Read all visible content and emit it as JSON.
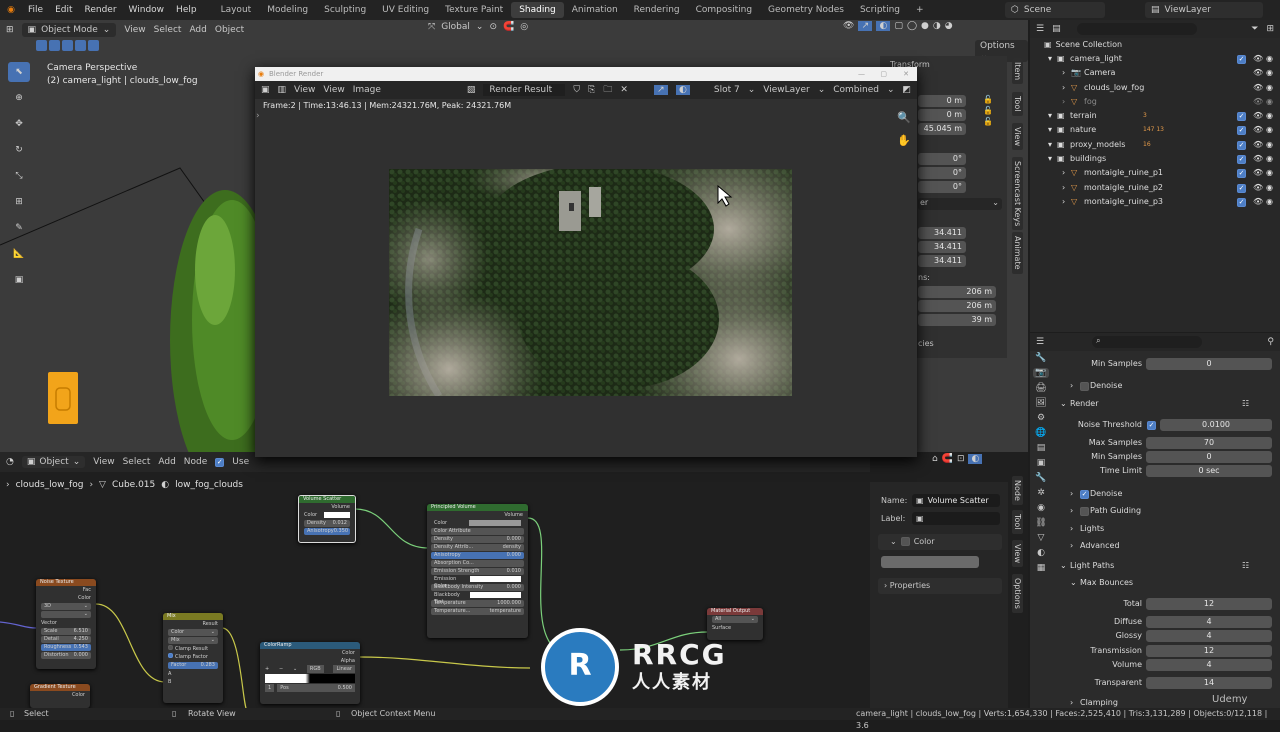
{
  "menu": {
    "items": [
      "File",
      "Edit",
      "Render",
      "Window",
      "Help"
    ]
  },
  "workspaces": {
    "tabs": [
      "Layout",
      "Modeling",
      "Sculpting",
      "UV Editing",
      "Texture Paint",
      "Shading",
      "Animation",
      "Rendering",
      "Compositing",
      "Geometry Nodes",
      "Scripting"
    ],
    "active": "Shading",
    "add": "+"
  },
  "scene": {
    "name": "Scene",
    "view_layer": "ViewLayer"
  },
  "viewport": {
    "mode": "Object Mode",
    "menus": [
      "View",
      "Select",
      "Add",
      "Object"
    ],
    "orientation": "Global",
    "options": "Options",
    "camera_title": "Camera Perspective",
    "camera_subtitle": "(2) camera_light | clouds_low_fog",
    "transform_label": "Transform",
    "side_tabs": [
      "Item",
      "Tool",
      "View",
      "Screencast Keys",
      "Animate"
    ],
    "transform_values": [
      "0 m",
      "0 m",
      "45.045 m",
      "0°",
      "0°",
      "0°",
      "34.411",
      "34.411",
      "34.411",
      "206 m",
      "206 m",
      "39 m"
    ],
    "dimensions_label": "ns:",
    "properties_label": "cies",
    "dropdown_label": "er"
  },
  "render_window": {
    "title": "Blender Render",
    "menus": [
      "View",
      "View",
      "Image"
    ],
    "image_name": "Render Result",
    "slot": "Slot 7",
    "view_layer": "ViewLayer",
    "pass": "Combined",
    "stats": "Frame:2 | Time:13:46.13 | Mem:24321.76M, Peak: 24321.76M"
  },
  "node_editor": {
    "mode": "Object",
    "menus": [
      "View",
      "Select",
      "Add",
      "Node"
    ],
    "use_nodes": "Use",
    "breadcrumb": [
      "clouds_low_fog",
      "Cube.015",
      "low_fog_clouds"
    ],
    "nodes": {
      "noise_texture": {
        "title": "Noise Texture",
        "outputs": [
          "Fac",
          "Color"
        ],
        "dim": "3D",
        "fbm": "",
        "inputs": [
          "Vector"
        ],
        "fields": [
          [
            "Scale",
            "6.510"
          ],
          [
            "Detail",
            "4.250"
          ],
          [
            "Roughness",
            "0.543"
          ],
          [
            "Distortion",
            "0.000"
          ]
        ]
      },
      "mix": {
        "title": "Mix",
        "output": "Result",
        "type": "Color",
        "blend": "Mix",
        "clamp_result": "Clamp Result",
        "clamp_factor": "Clamp Factor",
        "factor_label": "Factor",
        "factor": "0.283",
        "a": "A",
        "b": "B"
      },
      "volume_scatter": {
        "title": "Volume Scatter",
        "output": "Volume",
        "color": "Color",
        "density_label": "Density",
        "density": "0.012",
        "aniso_label": "Anisotropy",
        "aniso": "0.350"
      },
      "principled_volume": {
        "title": "Principled Volume",
        "output": "Volume",
        "rows": [
          [
            "Color",
            ""
          ],
          [
            "Color Attribute",
            ""
          ],
          [
            "Density",
            "0.000"
          ],
          [
            "Density Attrib...",
            "density"
          ],
          [
            "Anisotropy",
            "0.000"
          ],
          [
            "Absorption Co...",
            ""
          ],
          [
            "Emission Strength",
            "0.010"
          ],
          [
            "Emission Color",
            ""
          ],
          [
            "Blackbody Intensity",
            "0.000"
          ],
          [
            "Blackbody Tint",
            ""
          ],
          [
            "Temperature",
            "1000.000"
          ],
          [
            "Temperature...",
            "temperature"
          ]
        ]
      },
      "color_ramp": {
        "title": "ColorRamp",
        "outputs": [
          "Color",
          "Alpha"
        ],
        "mode": "RGB",
        "interp": "Linear",
        "pos_label": "Pos",
        "pos": "0.500",
        "index": "1"
      },
      "gradient_texture": {
        "title": "Gradient Texture",
        "output": "Color"
      },
      "material_output": {
        "title": "Material Output",
        "target": "All",
        "input": "Surface"
      }
    }
  },
  "node_sidebar": {
    "name_label": "Name:",
    "name_value": "Volume Scatter",
    "label_label": "Label:",
    "label_value": "",
    "color_label": "Color",
    "properties_label": "Properties",
    "tabs": [
      "Node",
      "Tool",
      "View",
      "Options"
    ]
  },
  "outliner": {
    "title": "Scene Collection",
    "items": [
      {
        "label": "camera_light",
        "level": 1,
        "check": true
      },
      {
        "label": "Camera",
        "level": 2,
        "check": false
      },
      {
        "label": "clouds_low_fog",
        "level": 2,
        "check": false
      },
      {
        "label": "fog",
        "level": 2,
        "check": false
      },
      {
        "label": "terrain",
        "level": 1,
        "check": true,
        "badge": "3"
      },
      {
        "label": "nature",
        "level": 1,
        "check": true,
        "badge": "147 13"
      },
      {
        "label": "proxy_models",
        "level": 1,
        "check": true,
        "badge": "16"
      },
      {
        "label": "buildings",
        "level": 1,
        "check": true
      },
      {
        "label": "montaigle_ruine_p1",
        "level": 2,
        "check": true
      },
      {
        "label": "montaigle_ruine_p2",
        "level": 2,
        "check": true
      },
      {
        "label": "montaigle_ruine_p3",
        "level": 2,
        "check": true
      }
    ]
  },
  "properties": {
    "search_placeholder": "",
    "rows": [
      {
        "label": "Min Samples",
        "value": "0"
      },
      {
        "label": "Denoise",
        "type": "sub"
      },
      {
        "label": "Render",
        "type": "section"
      },
      {
        "label": "Noise Threshold",
        "value": "0.0100",
        "check": true
      },
      {
        "label": "Max Samples",
        "value": "70"
      },
      {
        "label": "Min Samples",
        "value": "0"
      },
      {
        "label": "Time Limit",
        "value": "0 sec"
      },
      {
        "label": "Denoise",
        "type": "sub-check"
      },
      {
        "label": "Path Guiding",
        "type": "sub-uncheck"
      },
      {
        "label": "Lights",
        "type": "sub"
      },
      {
        "label": "Advanced",
        "type": "sub"
      },
      {
        "label": "Light Paths",
        "type": "section"
      },
      {
        "label": "Max Bounces",
        "type": "section2"
      },
      {
        "label": "Total",
        "value": "12"
      },
      {
        "label": "Diffuse",
        "value": "4"
      },
      {
        "label": "Glossy",
        "value": "4"
      },
      {
        "label": "Transmission",
        "value": "12"
      },
      {
        "label": "Volume",
        "value": "4"
      },
      {
        "label": "Transparent",
        "value": "14"
      },
      {
        "label": "Clamping",
        "type": "sub"
      }
    ]
  },
  "statusbar": {
    "select": "Select",
    "rotate": "Rotate View",
    "context": "Object Context Menu",
    "stats": "camera_light | clouds_low_fog | Verts:1,654,330 | Faces:2,525,410 | Tris:3,131,289 | Objects:0/12,118 | 3.6"
  },
  "watermark": {
    "logo": "RRCG",
    "cn": "人人素材",
    "udemy": "Udemy"
  },
  "colors": {
    "accent": "#4772b3",
    "node_output": "#7b3a3a",
    "node_texture": "#8a4a1f",
    "node_shader": "#2f6b2f",
    "node_converter": "#2b5a7a"
  }
}
